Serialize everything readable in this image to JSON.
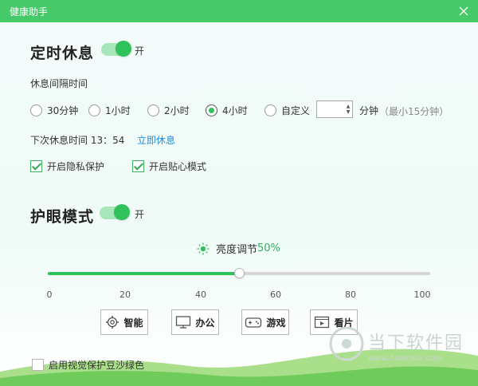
{
  "window": {
    "title": "健康助手",
    "close_icon": "close-icon"
  },
  "rest": {
    "title": "定时休息",
    "toggle_on": true,
    "toggle_label": "开",
    "interval_label": "休息间隔时间",
    "options": [
      {
        "label": "30分钟",
        "selected": false
      },
      {
        "label": "1小时",
        "selected": false
      },
      {
        "label": "2小时",
        "selected": false
      },
      {
        "label": "4小时",
        "selected": true
      },
      {
        "label": "自定义",
        "selected": false
      }
    ],
    "custom_value": "",
    "custom_unit": "分钟",
    "custom_hint": "（最小15分钟）",
    "next_rest_label": "下次休息时间 13：54",
    "rest_now_link": "立即休息",
    "privacy_label": "开启隐私保护",
    "privacy_checked": true,
    "caring_label": "开启贴心模式",
    "caring_checked": true
  },
  "eye": {
    "title": "护眼模式",
    "toggle_on": true,
    "toggle_label": "开",
    "brightness_label": "亮度调节",
    "brightness_value": "50%",
    "brightness_level": 50,
    "ticks": [
      "0",
      "20",
      "40",
      "60",
      "80",
      "100"
    ],
    "modes": [
      {
        "label": "智能",
        "icon": "smart-gear-icon"
      },
      {
        "label": "办公",
        "icon": "monitor-icon"
      },
      {
        "label": "游戏",
        "icon": "gamepad-icon"
      },
      {
        "label": "看片",
        "icon": "video-icon"
      }
    ],
    "bean_green_label": "启用视觉保护豆沙绿色",
    "bean_green_checked": false
  },
  "watermark": {
    "brand": "当下软件园",
    "url": "www.downxia.com"
  },
  "colors": {
    "accent": "#2fc25b",
    "titlebar": "#45c969",
    "link": "#1a8ee8"
  }
}
